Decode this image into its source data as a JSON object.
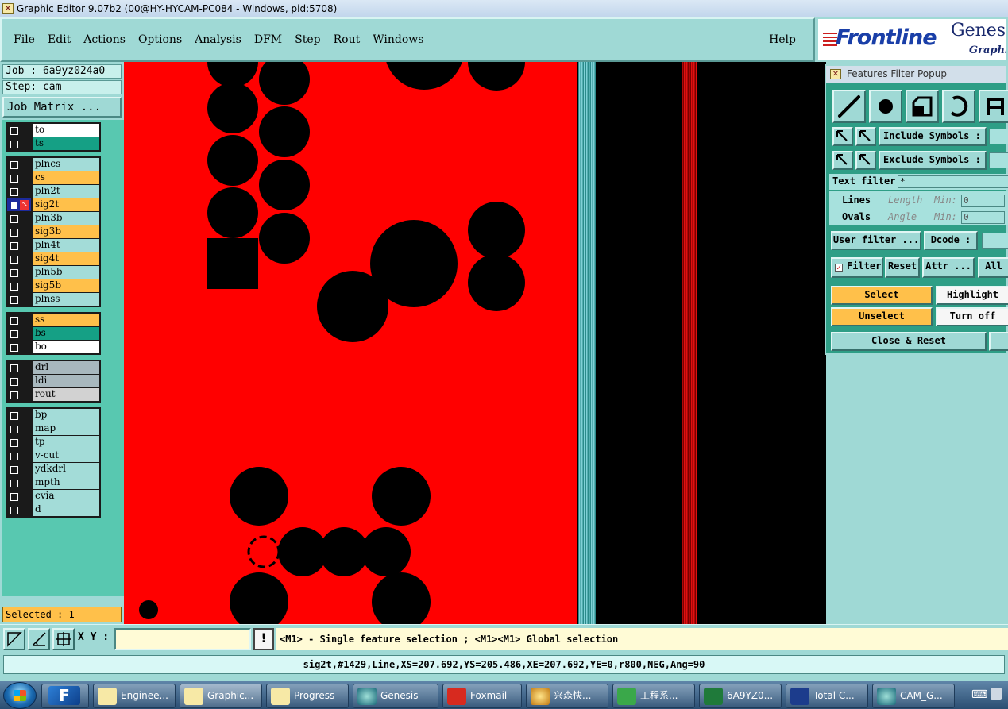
{
  "window": {
    "title": "Graphic Editor 9.07b2 (00@HY-HYCAM-PC084 - Windows, pid:5708)"
  },
  "menu": {
    "items": [
      "File",
      "Edit",
      "Actions",
      "Options",
      "Analysis",
      "DFM",
      "Step",
      "Rout",
      "Windows"
    ],
    "help": "Help"
  },
  "logo": {
    "brand": "Frontline",
    "product": "Genesi",
    "sub": "Graphic"
  },
  "job": {
    "job_line": "Job : 6a9yz024a0",
    "step_line": "Step: cam",
    "matrix_button": "Job Matrix ..."
  },
  "layers": [
    {
      "group": 0,
      "name": "to",
      "color": "white"
    },
    {
      "group": 0,
      "name": "ts",
      "color": "green"
    },
    {
      "group": 1,
      "name": "plncs",
      "color": "cyan"
    },
    {
      "group": 1,
      "name": "cs",
      "color": "orange"
    },
    {
      "group": 1,
      "name": "pln2t",
      "color": "cyan"
    },
    {
      "group": 1,
      "name": "sig2t",
      "color": "orange",
      "active": true
    },
    {
      "group": 1,
      "name": "pln3b",
      "color": "cyan"
    },
    {
      "group": 1,
      "name": "sig3b",
      "color": "orange"
    },
    {
      "group": 1,
      "name": "pln4t",
      "color": "cyan"
    },
    {
      "group": 1,
      "name": "sig4t",
      "color": "orange"
    },
    {
      "group": 1,
      "name": "pln5b",
      "color": "cyan"
    },
    {
      "group": 1,
      "name": "sig5b",
      "color": "orange"
    },
    {
      "group": 1,
      "name": "plnss",
      "color": "cyan"
    },
    {
      "group": 2,
      "name": "ss",
      "color": "orange"
    },
    {
      "group": 2,
      "name": "bs",
      "color": "green"
    },
    {
      "group": 2,
      "name": "bo",
      "color": "white"
    },
    {
      "group": 3,
      "name": "drl",
      "color": "grey"
    },
    {
      "group": 3,
      "name": "ldi",
      "color": "grey"
    },
    {
      "group": 3,
      "name": "rout",
      "color": "lgrey"
    },
    {
      "group": 4,
      "name": "bp",
      "color": "cyan"
    },
    {
      "group": 4,
      "name": "map",
      "color": "cyan"
    },
    {
      "group": 4,
      "name": "tp",
      "color": "cyan"
    },
    {
      "group": 4,
      "name": "v-cut",
      "color": "cyan"
    },
    {
      "group": 4,
      "name": "ydkdrl",
      "color": "cyan"
    },
    {
      "group": 4,
      "name": "mpth",
      "color": "cyan"
    },
    {
      "group": 4,
      "name": "cvia",
      "color": "cyan"
    },
    {
      "group": 4,
      "name": "d",
      "color": "cyan"
    }
  ],
  "selected": "Selected : 1",
  "filter_popup": {
    "title": "Features Filter Popup",
    "include_symbols": "Include Symbols :",
    "exclude_symbols": "Exclude Symbols :",
    "text_filter_label": "Text filter",
    "text_filter_value": "*",
    "lines": "Lines",
    "ovals": "Ovals",
    "length": "Length",
    "angle": "Angle",
    "min1": "Min:",
    "min2": "Min:",
    "min_value1": "0",
    "min_value2": "0",
    "user_filter": "User filter ...",
    "dcode": "Dcode :",
    "filter": "Filter",
    "reset": "Reset",
    "attr": "Attr ...",
    "all": "All",
    "select": "Select",
    "highlight": "Highlight",
    "unselect": "Unselect",
    "turn_off": "Turn off",
    "close_reset": "Close & Reset"
  },
  "status": {
    "xy_label": "X Y :",
    "xy_value": "",
    "bang": "!",
    "hint": "<M1> - Single feature selection ; <M1><M1> Global selection",
    "info": "sig2t,#1429,Line,XS=207.692,YS=205.486,XE=207.692,YE=0,r800,NEG,Ang=90"
  },
  "taskbar": {
    "items": [
      "Enginee...",
      "Graphic...",
      "Progress",
      "Genesis",
      "Foxmail",
      "兴森快...",
      "工程系...",
      "6A9YZ0...",
      "Total C...",
      "CAM_G..."
    ]
  },
  "colors": {
    "panel": "#9fd9d5",
    "copper": "#ff0000",
    "background": "#000000",
    "selected": "#ffc04a"
  }
}
